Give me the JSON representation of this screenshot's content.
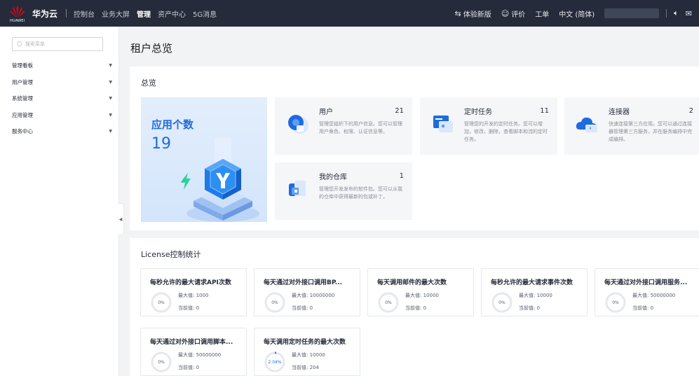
{
  "topbar": {
    "brand": "华为云",
    "brand_sub": "HUAWEI",
    "nav": [
      "控制台",
      "业务大屏",
      "管理",
      "资产中心",
      "5G消息"
    ],
    "active_nav": "管理",
    "new_version": "体验新版",
    "rating": "评价",
    "ticket": "工单",
    "language": "中文 (简体)"
  },
  "sidebar": {
    "search_placeholder": "搜索菜单",
    "items": [
      {
        "label": "管理看板"
      },
      {
        "label": "用户管理"
      },
      {
        "label": "系统管理"
      },
      {
        "label": "应用管理"
      },
      {
        "label": "服务中心"
      }
    ]
  },
  "page": {
    "title": "租户总览"
  },
  "overview": {
    "title": "总览",
    "hero_label": "应用个数",
    "hero_count": "19",
    "cards": [
      {
        "title": "用户",
        "count": "21",
        "desc": "管理您组织下的用户信息。您可以管理用户角色、权限、认证信息等。",
        "icon": "users-icon"
      },
      {
        "title": "定时任务",
        "count": "11",
        "desc": "管理您的开发的定时任务。您可以增加，修改，删除，查看脚本和流的定时任务。",
        "icon": "schedule-icon"
      },
      {
        "title": "连接器",
        "count": "2",
        "desc": "快速连接第三方应用。您可以通过连接器管理第三方服务，并在服务编排中完成编排。",
        "icon": "cloud-connector-icon"
      },
      {
        "title": "我的仓库",
        "count": "1",
        "desc": "管理您开发发布的软件包。您可以从我的仓库中获得最新的包或补丁。",
        "icon": "repository-icon"
      }
    ]
  },
  "license": {
    "title": "License控制统计",
    "max_prefix": "最大值: ",
    "cur_prefix": "当前值: ",
    "items": [
      {
        "title": "每秒允许的最大请求API次数",
        "percent": "0%",
        "max": "1000",
        "current": "0",
        "ratio": 0
      },
      {
        "title": "每天通过对外接口调用BP...",
        "percent": "0%",
        "max": "10000000",
        "current": "0",
        "ratio": 0
      },
      {
        "title": "每天调用邮件的最大次数",
        "percent": "0%",
        "max": "10000",
        "current": "0",
        "ratio": 0
      },
      {
        "title": "每秒允许的最大请求事件次数",
        "percent": "0%",
        "max": "10000",
        "current": "0",
        "ratio": 0
      },
      {
        "title": "每天通过对外接口调用服务...",
        "percent": "0%",
        "max": "50000000",
        "current": "0",
        "ratio": 0
      },
      {
        "title": "每天通过对外接口调用脚本...",
        "percent": "0%",
        "max": "50000000",
        "current": "0",
        "ratio": 0
      },
      {
        "title": "每天调用定时任务的最大次数",
        "percent": "2.04%",
        "max": "10000",
        "current": "204",
        "ratio": 0.0204
      }
    ]
  },
  "colors": {
    "topbar_bg": "#252b3a",
    "accent": "#1e6be0",
    "ring_track": "#e6e8eb",
    "ring_fill": "#1e6be0"
  }
}
